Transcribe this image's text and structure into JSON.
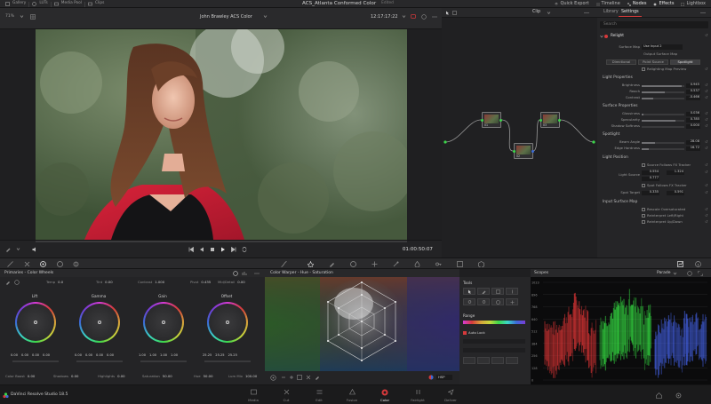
{
  "top_bar": {
    "left_items": [
      "Gallery",
      "LUTs",
      "Media Pool",
      "Clips"
    ],
    "project_title": "ACS_Atlanta Conformed Color",
    "project_status": "Edited",
    "right_items": [
      {
        "label": "Quick Export",
        "active": false
      },
      {
        "label": "Timeline",
        "active": false
      },
      {
        "label": "Nodes",
        "active": true
      },
      {
        "label": "Effects",
        "active": true
      },
      {
        "label": "Lightbox",
        "active": false
      }
    ]
  },
  "viewer": {
    "zoom": "71%",
    "clip_name": "John Brawley ACS Color",
    "timecode_top": "12:17:17:22",
    "timecode": "01:00:50:07"
  },
  "node_editor": {
    "mode": "Clip",
    "nodes": [
      {
        "num": "01"
      },
      {
        "num": "02"
      },
      {
        "num": "03"
      }
    ]
  },
  "settings": {
    "tabs": [
      "Library",
      "Settings"
    ],
    "active_tab": "Settings",
    "search_placeholder": "Search",
    "effect_name": "Relight",
    "surface_map_label": "Surface Map",
    "surface_map_value": "Use Input 2",
    "output_surface_map": "Output Surface Map",
    "directional": "Directional",
    "point_source": "Point Source",
    "spotlight_btn": "Spotlight",
    "relighting_preview": "Relighting Map Preview",
    "light_properties": "Light Properties",
    "brightness_label": "Brightness",
    "brightness_val": "0.945",
    "reach_label": "Reach",
    "reach_val": "0.537",
    "contrast_label": "Contrast",
    "contrast_val": "-0.466",
    "surface_properties": "Surface Properties",
    "glossiness_label": "Glossiness",
    "glossiness_val": "0.036",
    "specularity_label": "Specularity",
    "specularity_val": "0.785",
    "shadow_softness_label": "Shadow Softness",
    "shadow_softness_val": "0.000",
    "spotlight": "Spotlight",
    "beam_angle_label": "Beam Angle",
    "beam_angle_val": "28.08",
    "edge_hardness_label": "Edge Hardness",
    "edge_hardness_val": "16.72",
    "light_position": "Light Position",
    "source_follows": "Source Follows FX Tracker",
    "light_source_label": "Light Source",
    "light_source_x": "0.554",
    "light_source_y": "1.324",
    "light_source_z": "0.777",
    "spot_follows": "Spot Follows FX Tracker",
    "spot_target_label": "Spot Target",
    "spot_target_x": "0.335",
    "spot_target_y": "0.591",
    "input_surface_map": "Input Surface Map",
    "rescale_oversaturated": "Rescale Oversaturated",
    "reinterpret_lr": "Reinterpret Left/Right",
    "reinterpret_ud": "Reinterpret Up/Down"
  },
  "primaries": {
    "title": "Primaries - Color Wheels",
    "params": [
      {
        "label": "Temp",
        "value": "0.0"
      },
      {
        "label": "Tint",
        "value": "0.00"
      },
      {
        "label": "Contrast",
        "value": "1.000"
      },
      {
        "label": "Pivot",
        "value": "0.435"
      },
      {
        "label": "Mid/Detail",
        "value": "0.00"
      }
    ],
    "wheels": [
      {
        "name": "Lift",
        "values": [
          "0.00",
          "0.00",
          "0.00",
          "0.00"
        ]
      },
      {
        "name": "Gamma",
        "values": [
          "0.00",
          "0.00",
          "0.00",
          "0.00"
        ]
      },
      {
        "name": "Gain",
        "values": [
          "1.00",
          "1.00",
          "1.00",
          "1.00"
        ]
      },
      {
        "name": "Offset",
        "values": [
          "25.25",
          "25.25",
          "25.25"
        ]
      }
    ],
    "bottom": [
      {
        "label": "Color Boost",
        "value": "0.00"
      },
      {
        "label": "Shadows",
        "value": "0.00"
      },
      {
        "label": "Highlights",
        "value": "0.00"
      },
      {
        "label": "Saturation",
        "value": "50.00"
      },
      {
        "label": "Hue",
        "value": "50.00"
      },
      {
        "label": "Lum Mix",
        "value": "100.00"
      }
    ]
  },
  "warper": {
    "title": "Color Warper - Hue - Saturation",
    "mode": "HSP"
  },
  "tools": {
    "title": "Tools",
    "range_label": "Range",
    "auto_lock": "Auto Lock"
  },
  "scopes": {
    "title": "Scopes",
    "mode": "Parade",
    "scale": [
      "1023",
      "896",
      "768",
      "640",
      "512",
      "384",
      "256",
      "128",
      "0"
    ]
  },
  "page_bar": {
    "brand": "DaVinci Resolve Studio 18.5",
    "pages": [
      {
        "label": "Media",
        "active": false
      },
      {
        "label": "Cut",
        "active": false
      },
      {
        "label": "Edit",
        "active": false
      },
      {
        "label": "Fusion",
        "active": false
      },
      {
        "label": "Color",
        "active": true
      },
      {
        "label": "Fairlight",
        "active": false
      },
      {
        "label": "Deliver",
        "active": false
      }
    ]
  },
  "colors": {
    "accent": "#d6393b",
    "panel": "#252527",
    "background": "#1f1f21"
  }
}
